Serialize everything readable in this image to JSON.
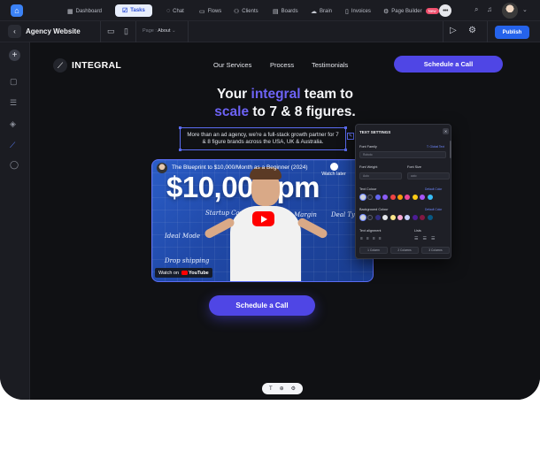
{
  "topnav": {
    "items": [
      {
        "label": "Dashboard",
        "icon": "grid-icon"
      },
      {
        "label": "Tasks",
        "icon": "checkbox-icon",
        "active": true
      },
      {
        "label": "Chat",
        "icon": "chat-icon"
      },
      {
        "label": "Flows",
        "icon": "flows-icon"
      },
      {
        "label": "Clients",
        "icon": "clients-icon"
      },
      {
        "label": "Boards",
        "icon": "boards-icon"
      },
      {
        "label": "Brain",
        "icon": "brain-icon"
      },
      {
        "label": "Invoices",
        "icon": "invoice-icon"
      },
      {
        "label": "Page Builder",
        "icon": "page-builder-icon",
        "badge": "New"
      }
    ],
    "more": "•••"
  },
  "editor": {
    "title": "Agency Website",
    "page_prefix": "Page :",
    "page_name": "About",
    "publish": "Publish"
  },
  "site": {
    "brand": "INTEGRAL",
    "nav": [
      "Our Services",
      "Process",
      "Testimonials"
    ],
    "cta_top": "Schedule a Call",
    "hero_line1_pre": "Your ",
    "hero_line1_accent": "integral",
    "hero_line1_post": " team to",
    "hero_line2_accent": "scale",
    "hero_line2_post": " to 7 & 8 figures.",
    "subtitle": "More than an ad agency, we're a full-stack growth partner for 7 & 8 figure brands across the USA, UK & Australia.",
    "cta_main": "Schedule a Call"
  },
  "video": {
    "title": "The Blueprint to $10,000/Month as a Beginner (2024)",
    "overlay_text": "$10,000/pm",
    "scribbles": [
      "Startup Capital",
      "Margin",
      "Deal Type",
      "Ideal Mode",
      "Drop shipping"
    ],
    "watch_later": "Watch later",
    "watch_on": "Watch on",
    "youtube": "YouTube"
  },
  "text_settings": {
    "title": "TEXT SETTINGS",
    "font_family_label": "Font Family",
    "font_family_link": "T: Global Text",
    "font_family_value": "Roboto",
    "font_weight_label": "Font Weight",
    "font_weight_value": "Auto",
    "font_size_label": "Font Size",
    "font_size_value": "auto",
    "text_colour_label": "Text Colour",
    "text_colour_link": "Default Color",
    "background_colour_label": "Background Colour",
    "background_colour_link": "Default Color",
    "text_alignment_label": "Text alignment",
    "lists_label": "Lists",
    "columns": [
      "1 Column",
      "2 Columns",
      "3 Columns"
    ],
    "text_swatches": [
      "#cfd2da",
      "#1f2230",
      "#6366f1",
      "#8b5cf6",
      "#ef4444",
      "#f59e0b",
      "#ec4899",
      "#facc15",
      "#a855f7",
      "#38bdf8"
    ],
    "bg_swatches": [
      "#cfd2da",
      "#1f2230",
      "#312e81",
      "#e5e7eb",
      "#fde68a",
      "#f9a8d4",
      "#c7d2fe",
      "#4c1d95",
      "#831843",
      "#075985"
    ]
  },
  "colors": {
    "accent": "#4f46e5",
    "publish": "#2563eb",
    "selection": "#5b6cf2"
  }
}
